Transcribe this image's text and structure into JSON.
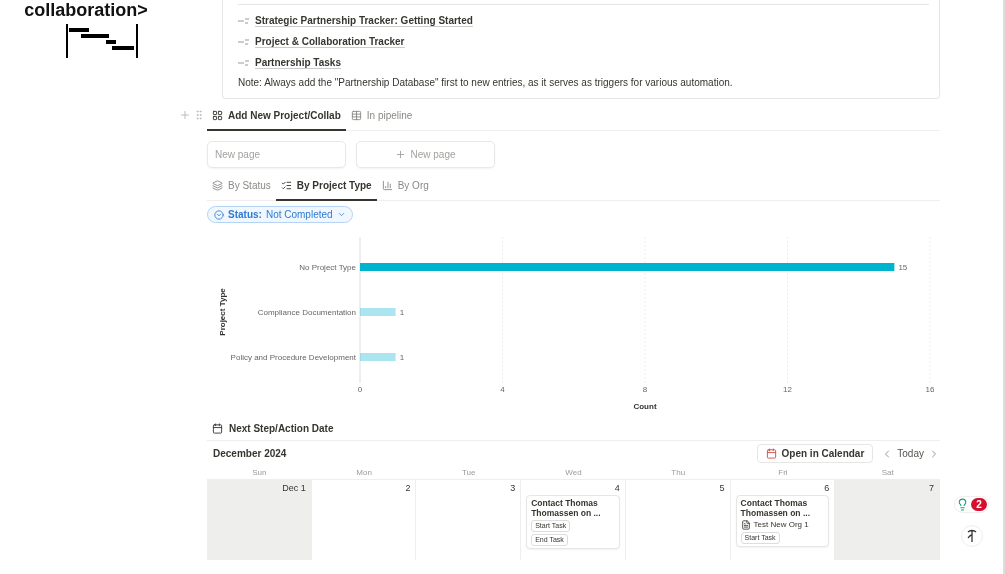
{
  "sidebar": {
    "heading": "collaboration>"
  },
  "callout": {
    "links": [
      {
        "label": "Strategic Partnership Tracker: Getting Started"
      },
      {
        "label": "Project & Collaboration Tracker"
      },
      {
        "label": "Partnership Tasks"
      }
    ],
    "note": "Note: Always add the \"Partnership Database\" first to new entries, as it serves as triggers for various automation."
  },
  "view_tabs": [
    {
      "kind": "gallery",
      "label": "Add New Project/Collab",
      "selected": true
    },
    {
      "kind": "table",
      "label": "In pipeline",
      "selected": false
    }
  ],
  "gallery_cards": [
    {
      "kind": "page",
      "label": "New page"
    },
    {
      "kind": "add",
      "label": "New page"
    }
  ],
  "chart_tabs": [
    {
      "kind": "status",
      "label": "By Status",
      "selected": false
    },
    {
      "kind": "type",
      "label": "By Project Type",
      "selected": true
    },
    {
      "kind": "org",
      "label": "By Org",
      "selected": false
    }
  ],
  "filter": {
    "label": "Status:",
    "value": "Not Completed"
  },
  "chart": {
    "chart_data": {
      "type": "bar",
      "orientation": "horizontal",
      "xlabel": "Count",
      "ylabel": "Project Type",
      "categories": [
        "No Project Type",
        "Compliance Documentation",
        "Policy and Procedure Development"
      ],
      "series": [
        {
          "color": "#00b4d0",
          "values": [
            15,
            1,
            1
          ]
        }
      ],
      "xlim": [
        0,
        16
      ],
      "xticks": [
        0,
        4,
        8,
        12,
        16
      ],
      "grid": true,
      "data_labels": true
    }
  },
  "calendar": {
    "title": "Next Step/Action Date",
    "month": "December 2024",
    "open_button": "Open in Calendar",
    "today": "Today",
    "weekdays": [
      "Sun",
      "Mon",
      "Tue",
      "Wed",
      "Thu",
      "Fri",
      "Sat"
    ],
    "days": [
      {
        "label": "Dec 1",
        "weekend": true
      },
      {
        "label": "2",
        "weekend": false
      },
      {
        "label": "3",
        "weekend": false
      },
      {
        "label": "4",
        "weekend": false,
        "events": [
          {
            "title": "Contact Thomas Thomassen on ...",
            "tags": [
              "Start Task",
              "End Task"
            ]
          }
        ]
      },
      {
        "label": "5",
        "weekend": false
      },
      {
        "label": "6",
        "weekend": false,
        "events": [
          {
            "title": "Contact Thomas Thomassen on ...",
            "org": "Test New Org 1",
            "tags": [
              "Start Task"
            ]
          }
        ]
      },
      {
        "label": "7",
        "weekend": true
      }
    ]
  },
  "notifications": {
    "count": "2"
  }
}
